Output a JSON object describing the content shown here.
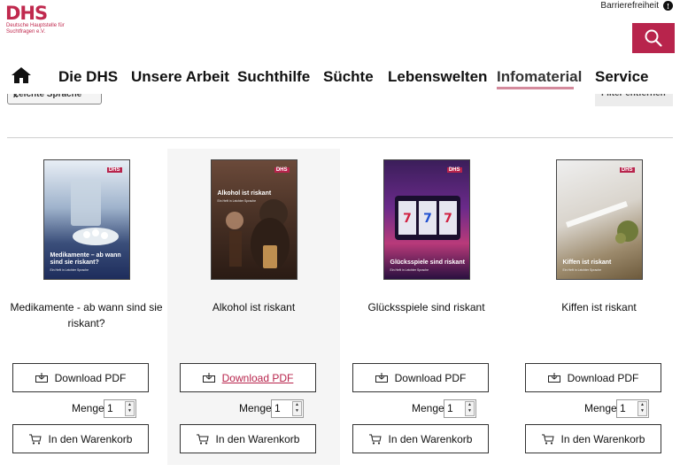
{
  "header": {
    "logo_text": "DHS",
    "logo_sub": "Deutsche Hauptstelle für Suchtfragen e.V.",
    "accessibility_label": "Barrierefreiheit",
    "accessibility_icon": "info-icon",
    "search_icon": "search-icon",
    "accent_color": "#b8244c"
  },
  "nav": {
    "home_icon": "home-icon",
    "items": [
      {
        "label": "Die DHS"
      },
      {
        "label": "Unsere Arbeit"
      },
      {
        "label": "Suchthilfe"
      },
      {
        "label": "Süchte"
      },
      {
        "label": "Lebenswelten"
      },
      {
        "label": "Infomaterial",
        "active": true
      },
      {
        "label": "Service"
      }
    ]
  },
  "filters": {
    "chip_label": "Leichte Sprache",
    "chip_close": "x",
    "reset_label": "Filter entfernen"
  },
  "products": [
    {
      "cover_logo": "DHS",
      "cover_title": "Medikamente – ab wann sind sie riskant?",
      "cover_sub": "Ein Heft in Leichter Sprache",
      "title": "Medikamente - ab wann sind sie riskant?",
      "download_label": "Download PDF",
      "qty_label": "Menge",
      "qty_value": "1",
      "cart_label": "In den Warenkorb"
    },
    {
      "cover_logo": "DHS",
      "cover_title": "Alkohol ist riskant",
      "cover_sub": "Ein Heft in Leichter Sprache",
      "title": "Alkohol ist riskant",
      "download_label": "Download PDF",
      "qty_label": "Menge",
      "qty_value": "1",
      "cart_label": "In den Warenkorb"
    },
    {
      "cover_logo": "DHS",
      "cover_title": "Glücksspiele sind riskant",
      "cover_sub": "Ein Heft in Leichter Sprache",
      "title": "Glücksspiele sind riskant",
      "download_label": "Download PDF",
      "qty_label": "Menge",
      "qty_value": "1",
      "cart_label": "In den Warenkorb"
    },
    {
      "cover_logo": "DHS",
      "cover_title": "Kiffen ist riskant",
      "cover_sub": "Ein Heft in Leichter Sprache",
      "title": "Kiffen ist riskant",
      "download_label": "Download PDF",
      "qty_label": "Menge",
      "qty_value": "1",
      "cart_label": "In den Warenkorb"
    }
  ]
}
